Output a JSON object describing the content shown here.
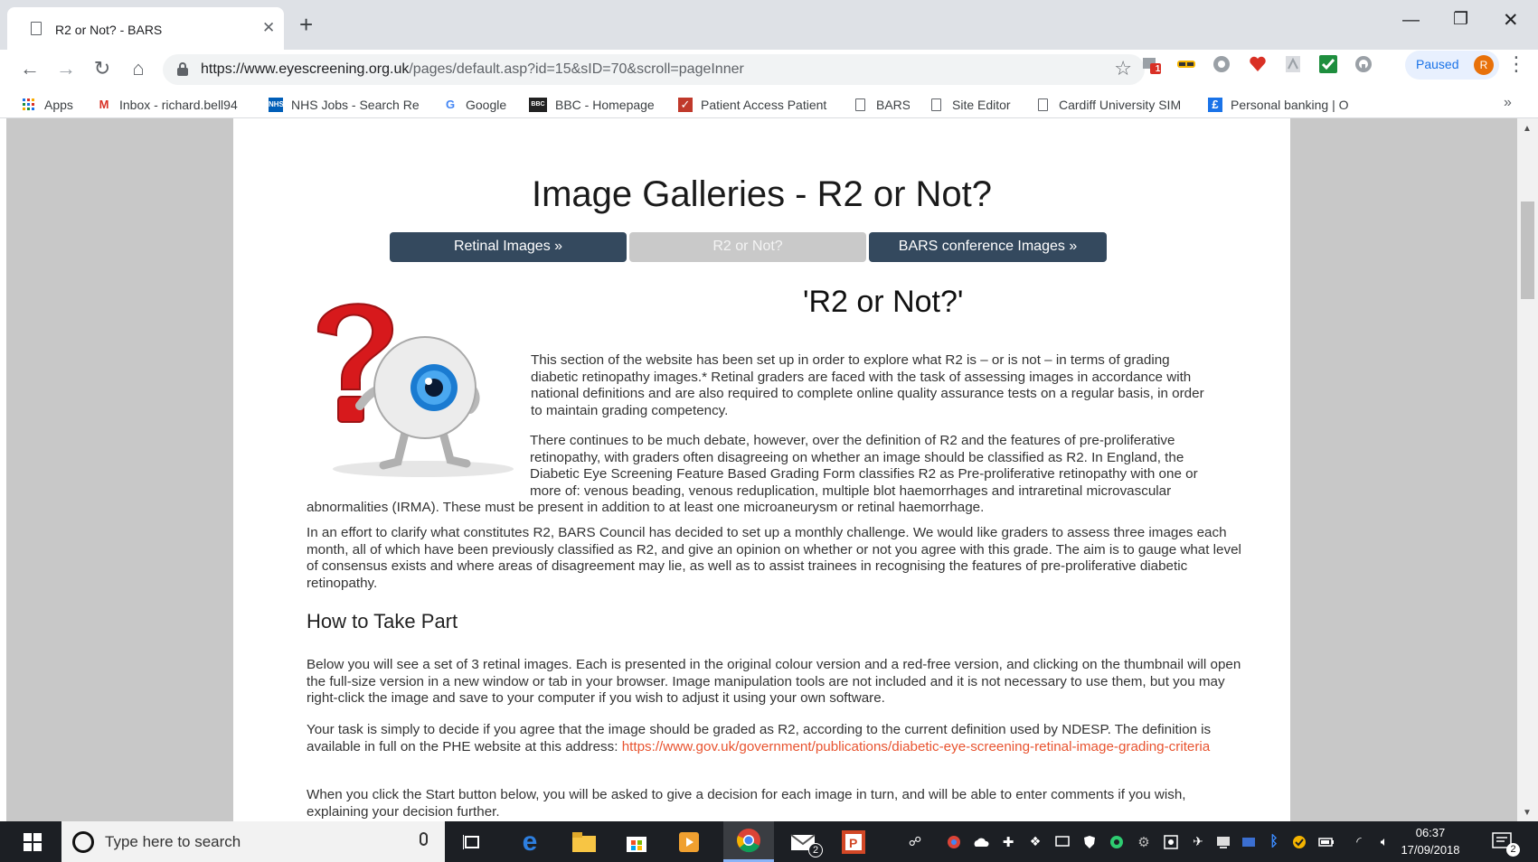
{
  "browser": {
    "tab_title": "R2 or Not? - BARS",
    "url_domain": "https://www.eyescreening.org.uk",
    "url_path": "/pages/default.asp?id=15&sID=70&scroll=pageInner",
    "profile_status": "Paused",
    "profile_initial": "R",
    "extension_badge": "1"
  },
  "bookmarks": [
    {
      "label": "Apps"
    },
    {
      "label": "Inbox - richard.bell94"
    },
    {
      "label": "NHS Jobs - Search Re"
    },
    {
      "label": "Google"
    },
    {
      "label": "BBC - Homepage"
    },
    {
      "label": "Patient Access Patient"
    },
    {
      "label": "BARS"
    },
    {
      "label": "Site Editor"
    },
    {
      "label": "Cardiff University SIM"
    },
    {
      "label": "Personal banking | O"
    }
  ],
  "page": {
    "title": "Image Galleries - R2 or Not?",
    "gallery_buttons": [
      {
        "label": "Retinal Images »"
      },
      {
        "label": "R2 or Not?"
      },
      {
        "label": "BARS conference Images »"
      }
    ],
    "heading": "'R2 or Not?'",
    "intro": "This section of the website has been set up in order to explore what R2 is – or is not – in terms of grading diabetic retinopathy images.* Retinal graders are faced with the task of assessing images in accordance with national definitions and are also required to complete online quality assurance tests on a regular basis, in order to maintain grading competency.",
    "debate": "There continues to be much debate, however, over the definition of R2 and the features of pre-proliferative retinopathy, with graders often disagreeing on whether an image should be classified as R2. In England, the Diabetic Eye Screening Feature Based Grading Form classifies R2 as Pre-proliferative retinopathy with one or more of: venous beading, venous reduplication, multiple blot haemorrhages and intraretinal microvascular abnormalities (IRMA). These must be present in addition to at least one microaneurysm or retinal haemorrhage.",
    "effort": "In an effort to clarify what constitutes R2, BARS Council has decided to set up a monthly challenge. We would like graders to assess three images each month, all of which have been previously classified as R2, and give an opinion on whether or not you agree with this grade. The aim is to gauge what level of consensus exists and where areas of disagreement may lie, as well as to assist trainees in recognising the features of pre-proliferative diabetic retinopathy.",
    "how_heading": "How to Take Part",
    "below": "Below you will see a set of 3 retinal images. Each is presented in the original colour version and a red-free version, and clicking on the thumbnail will open the full-size version in a new window or tab in your browser. Image manipulation tools are not included and it is not necessary to use them, but you may right-click the image and save to your computer if you wish to adjust it using your own software.",
    "task_text": "Your task is simply to decide if you agree that the image should be graded as R2, according to the current definition used by NDESP. The definition is available in full on the PHE website at this address:",
    "task_link": "https://www.gov.uk/government/publications/diabetic-eye-screening-retinal-image-grading-criteria",
    "start_text": "When you click the Start button below, you will be asked to give a decision for each image in turn, and will be able to enter comments if you wish, explaining your decision further."
  },
  "taskbar": {
    "search_placeholder": "Type here to search",
    "time": "06:37",
    "date": "17/09/2018",
    "mail_badge": "2",
    "notification_count": "2"
  },
  "colors": {
    "gallery_button": "#34495e",
    "gallery_button_active": "#c9c9c9",
    "link": "#e8532f"
  }
}
